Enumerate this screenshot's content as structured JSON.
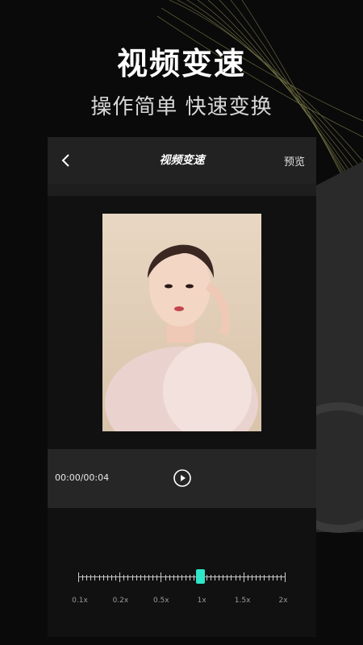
{
  "promo": {
    "headline": "视频变速",
    "subline": "操作简单 快速变换"
  },
  "header": {
    "back_icon": "chevron-left-icon",
    "title": "视频变速",
    "preview_label": "预览"
  },
  "player": {
    "time": "00:00/00:04",
    "play_icon": "play-circle-icon"
  },
  "speed": {
    "options": [
      "0.1x",
      "0.2x",
      "0.5x",
      "1x",
      "1.5x",
      "2x"
    ],
    "selected": "1x"
  },
  "colors": {
    "accent": "#2ee6c9",
    "background": "#0a0a0a",
    "panel": "#1e1e1e"
  }
}
